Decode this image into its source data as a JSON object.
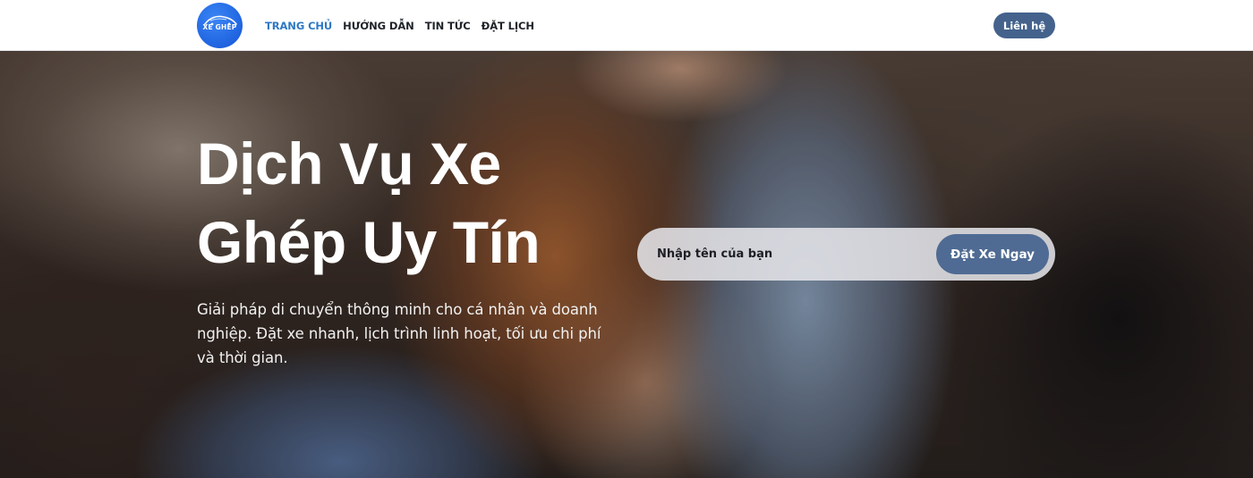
{
  "header": {
    "logo_text": "XE GHÉP",
    "nav": [
      {
        "label": "TRANG CHỦ",
        "active": true
      },
      {
        "label": "HƯỚNG DẪN",
        "active": false
      },
      {
        "label": "TIN TỨC",
        "active": false
      },
      {
        "label": "ĐẶT LỊCH",
        "active": false
      }
    ],
    "contact_label": "Liên hệ"
  },
  "hero": {
    "title_line1": "Dịch Vụ Xe",
    "title_line2": "Ghép Uy Tín",
    "description": "Giải pháp di chuyển thông minh cho cá nhân và doanh nghiệp. Đặt xe nhanh, lịch trình linh hoạt, tối ưu chi phí và thời gian.",
    "form": {
      "input_placeholder": "Nhập tên của bạn",
      "input_value": "",
      "submit_label": "Đặt Xe Ngay"
    }
  },
  "colors": {
    "accent_blue": "#2f78c4",
    "button_blue": "#44628c",
    "logo_blue": "#1f63e0"
  },
  "icons": {
    "logo": "car-logo-icon"
  }
}
